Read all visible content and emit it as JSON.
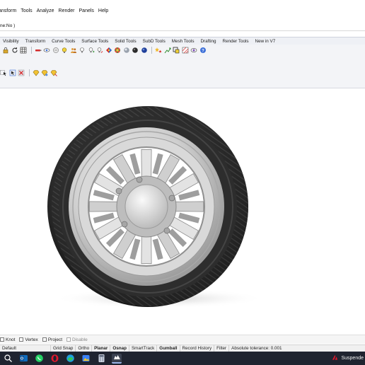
{
  "menu": [
    "ansform",
    "Tools",
    "Analyze",
    "Render",
    "Panels",
    "Help"
  ],
  "command_line": "ne:No )",
  "tabs": [
    "Visibility",
    "Transform",
    "Curve Tools",
    "Surface Tools",
    "Solid Tools",
    "SubD Tools",
    "Mesh Tools",
    "Drafting",
    "Render Tools",
    "New in V7"
  ],
  "toolbar_icons": [
    "lock-icon",
    "circle-arrow-icon",
    "grid-icon",
    "paint-icon",
    "eye-icon",
    "ghost-icon",
    "lamp-icon",
    "people-icon",
    "bulb-icon",
    "bulb-plus-icon",
    "bulb-arrow-icon",
    "material-icon",
    "globe-icon",
    "sphere-icon",
    "sphere-dark-icon",
    "sphere-blue-icon",
    "stars-icon",
    "arrows-icon",
    "frame-icon",
    "hatch-icon",
    "eye2-icon",
    "help-icon"
  ],
  "toolbar2_icons": [
    "select-icon",
    "pointer-icon",
    "delete-icon",
    "diamond-icon",
    "diamond2-icon",
    "diamond3-icon"
  ],
  "osnaps": [
    {
      "label": "Knot",
      "checked": false,
      "disabled": false
    },
    {
      "label": "Vertex",
      "checked": false,
      "disabled": false
    },
    {
      "label": "Project",
      "checked": false,
      "disabled": false
    },
    {
      "label": "Disable",
      "checked": false,
      "disabled": true
    }
  ],
  "status": {
    "layer": "Default",
    "items": [
      {
        "label": "Grid Snap",
        "bold": false
      },
      {
        "label": "Ortho",
        "bold": false
      },
      {
        "label": "Planar",
        "bold": true
      },
      {
        "label": "Osnap",
        "bold": true
      },
      {
        "label": "SmartTrack",
        "bold": false
      },
      {
        "label": "Gumball",
        "bold": true
      },
      {
        "label": "Record History",
        "bold": false
      },
      {
        "label": "Filter",
        "bold": false
      }
    ],
    "tolerance": "Absolute tolerance: 0.001"
  },
  "taskbar": {
    "apps": [
      "search-icon",
      "outlook-icon",
      "whatsapp-icon",
      "opera-icon",
      "edge-icon",
      "photos-icon",
      "calculator-icon",
      "rhino-icon"
    ],
    "notification": "Suspende"
  },
  "colors": {
    "accent": "#3c6fd8",
    "taskbar": "#1f2430",
    "tire": "#222222",
    "rim": "#c9c9c9"
  }
}
